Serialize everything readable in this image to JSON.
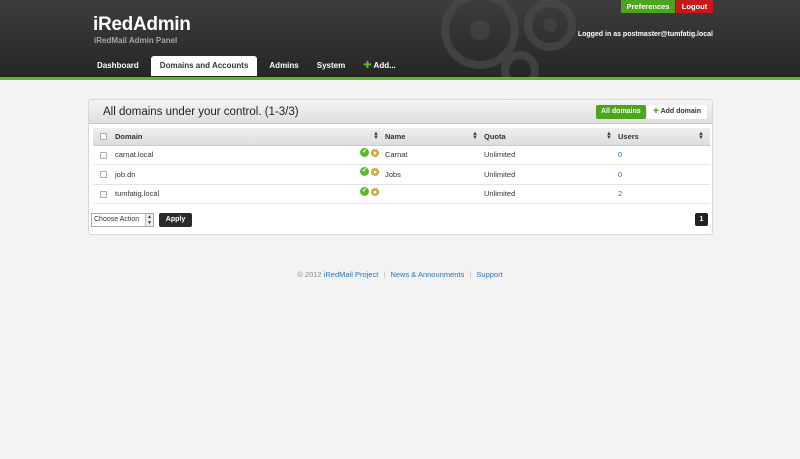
{
  "header": {
    "title": "iRedAdmin",
    "subtitle": "iRedMail Admin Panel",
    "preferences_label": "Preferences",
    "logout_label": "Logout",
    "logged_in_text": "Logged in as postmaster@tumfatig.local"
  },
  "nav": {
    "items": [
      {
        "label": "Dashboard"
      },
      {
        "label": "Domains and Accounts"
      },
      {
        "label": "Admins"
      },
      {
        "label": "System"
      },
      {
        "label": "Add..."
      }
    ],
    "active": "Domains and Accounts"
  },
  "panel": {
    "title": "All domains under your control. (1-3/3)",
    "tab_all": "All domains",
    "tab_add": "Add domain"
  },
  "table": {
    "columns": [
      "Domain",
      "Name",
      "Quota",
      "Users"
    ],
    "rows": [
      {
        "domain": "carnat.local",
        "name": "Carnat",
        "quota": "Unlimited",
        "users": "0"
      },
      {
        "domain": "job.dn",
        "name": "Jobs",
        "quota": "Unlimited",
        "users": "0"
      },
      {
        "domain": "tumfatig.local",
        "name": "",
        "quota": "Unlimited",
        "users": "2"
      }
    ]
  },
  "actions": {
    "select_value": "Choose Action",
    "apply_label": "Apply",
    "page": "1"
  },
  "footer": {
    "copyright": "© 2012",
    "project_link": "iRedMail Project",
    "news_link": "News & Announments",
    "support_link": "Support"
  },
  "colors": {
    "accent_green": "#5cb92a",
    "logout_red": "#c41a1a",
    "link_blue": "#2a74b9"
  }
}
